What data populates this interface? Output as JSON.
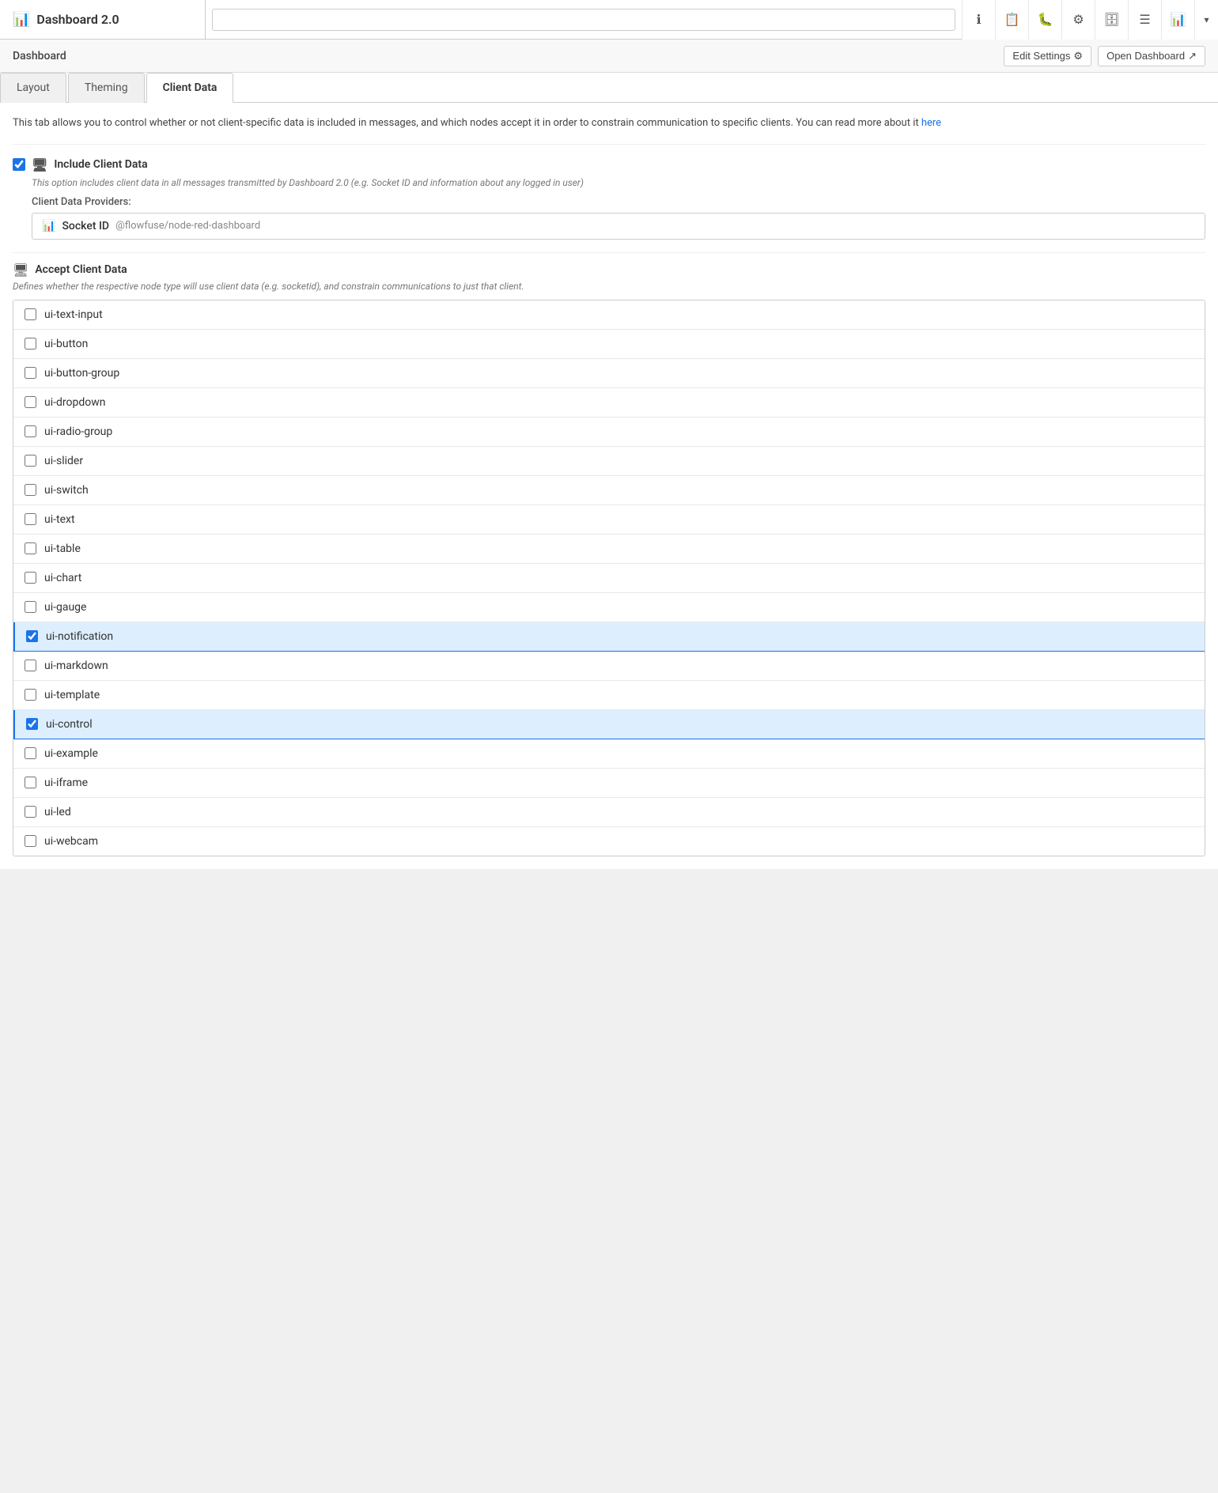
{
  "titleBar": {
    "icon": "📊",
    "title": "Dashboard 2.0",
    "searchPlaceholder": ""
  },
  "toolbarIcons": [
    {
      "name": "info-icon",
      "symbol": "ℹ",
      "label": "Info"
    },
    {
      "name": "book-icon",
      "symbol": "📋",
      "label": "Book"
    },
    {
      "name": "bug-icon",
      "symbol": "🐛",
      "label": "Bug"
    },
    {
      "name": "settings-icon",
      "symbol": "⚙",
      "label": "Settings"
    },
    {
      "name": "database-icon",
      "symbol": "🗄",
      "label": "Database"
    },
    {
      "name": "layers-icon",
      "symbol": "☰",
      "label": "Layers"
    },
    {
      "name": "chart-icon",
      "symbol": "📊",
      "label": "Chart"
    },
    {
      "name": "dropdown-icon",
      "symbol": "▾",
      "label": "Dropdown"
    }
  ],
  "subHeader": {
    "title": "Dashboard",
    "editSettingsLabel": "Edit Settings",
    "editSettingsIcon": "⚙",
    "openDashboardLabel": "Open Dashboard",
    "openDashboardIcon": "↗"
  },
  "tabs": [
    {
      "id": "layout",
      "label": "Layout",
      "active": false
    },
    {
      "id": "theming",
      "label": "Theming",
      "active": false
    },
    {
      "id": "client-data",
      "label": "Client Data",
      "active": true
    }
  ],
  "clientDataTab": {
    "description": "This tab allows you to control whether or not client-specific data is included in messages, and which nodes accept it in order to constrain communication to specific clients. You can read more about it",
    "descriptionLinkText": "here",
    "descriptionLinkHref": "#",
    "includeClientData": {
      "checked": true,
      "label": "Include Client Data",
      "icon": "🖥",
      "hint": "This option includes client data in all messages transmitted by Dashboard 2.0 (e.g. Socket ID and information about any logged in user)",
      "providersLabel": "Client Data Providers:",
      "provider": {
        "icon": "📊",
        "name": "Socket ID",
        "description": "@flowfuse/node-red-dashboard"
      }
    },
    "acceptClientData": {
      "sectionIcon": "🖥",
      "title": "Accept Client Data",
      "hint": "Defines whether the respective node type will use client data (e.g. socketid), and constrain communications to just that client.",
      "items": [
        {
          "id": "ui-text-input",
          "label": "ui-text-input",
          "checked": false
        },
        {
          "id": "ui-button",
          "label": "ui-button",
          "checked": false
        },
        {
          "id": "ui-button-group",
          "label": "ui-button-group",
          "checked": false
        },
        {
          "id": "ui-dropdown",
          "label": "ui-dropdown",
          "checked": false
        },
        {
          "id": "ui-radio-group",
          "label": "ui-radio-group",
          "checked": false
        },
        {
          "id": "ui-slider",
          "label": "ui-slider",
          "checked": false
        },
        {
          "id": "ui-switch",
          "label": "ui-switch",
          "checked": false
        },
        {
          "id": "ui-text",
          "label": "ui-text",
          "checked": false
        },
        {
          "id": "ui-table",
          "label": "ui-table",
          "checked": false
        },
        {
          "id": "ui-chart",
          "label": "ui-chart",
          "checked": false
        },
        {
          "id": "ui-gauge",
          "label": "ui-gauge",
          "checked": false
        },
        {
          "id": "ui-notification",
          "label": "ui-notification",
          "checked": true
        },
        {
          "id": "ui-markdown",
          "label": "ui-markdown",
          "checked": false
        },
        {
          "id": "ui-template",
          "label": "ui-template",
          "checked": false
        },
        {
          "id": "ui-control",
          "label": "ui-control",
          "checked": true
        },
        {
          "id": "ui-example",
          "label": "ui-example",
          "checked": false
        },
        {
          "id": "ui-iframe",
          "label": "ui-iframe",
          "checked": false
        },
        {
          "id": "ui-led",
          "label": "ui-led",
          "checked": false
        },
        {
          "id": "ui-webcam",
          "label": "ui-webcam",
          "checked": false
        }
      ]
    }
  }
}
